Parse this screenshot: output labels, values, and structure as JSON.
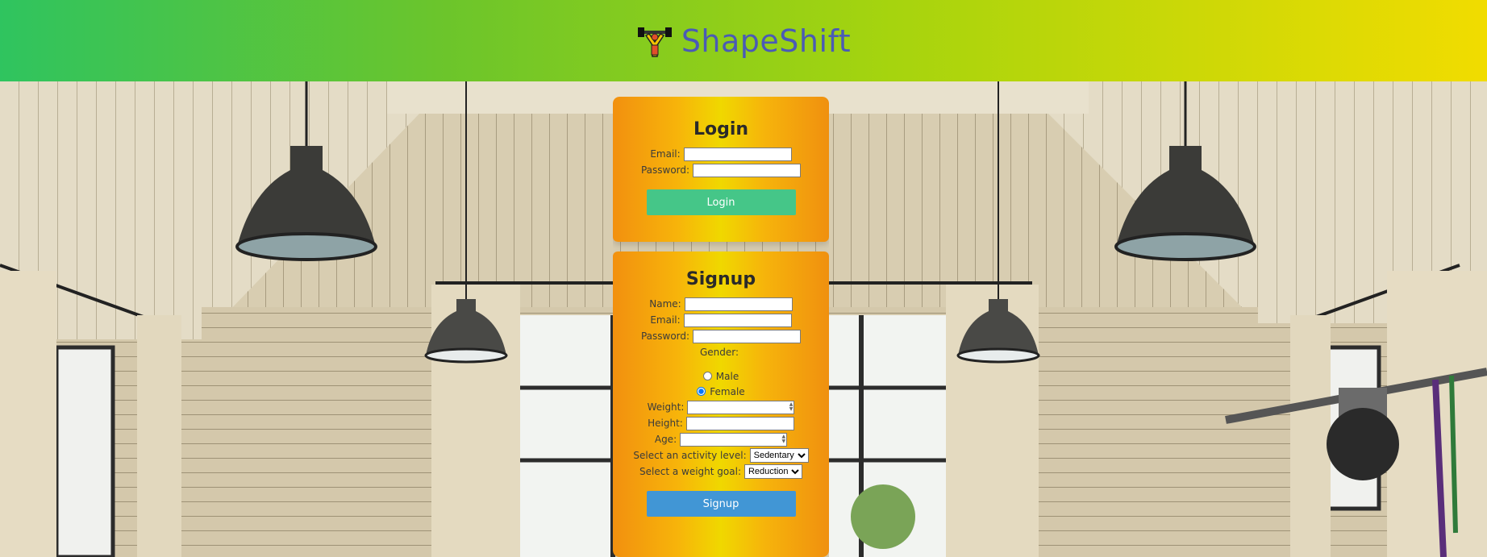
{
  "header": {
    "brand": "ShapeShift"
  },
  "login": {
    "title": "Login",
    "email_label": "Email:",
    "password_label": "Password:",
    "button": "Login"
  },
  "signup": {
    "title": "Signup",
    "name_label": "Name:",
    "email_label": "Email:",
    "password_label": "Password:",
    "gender_label": "Gender:",
    "gender_options": [
      "Male",
      "Female"
    ],
    "gender_selected": "Female",
    "weight_label": "Weight:",
    "height_label": "Height:",
    "age_label": "Age:",
    "activity_label": "Select an activity level:",
    "activity_value": "Sedentary",
    "goal_label": "Select a weight goal:",
    "goal_value": "Reduction",
    "button": "Signup"
  },
  "colors": {
    "header_start": "#2fc45f",
    "header_end": "#f1dc00",
    "brand": "#4a5bb5",
    "login_button": "#45c688",
    "signup_button": "#4196d5"
  }
}
